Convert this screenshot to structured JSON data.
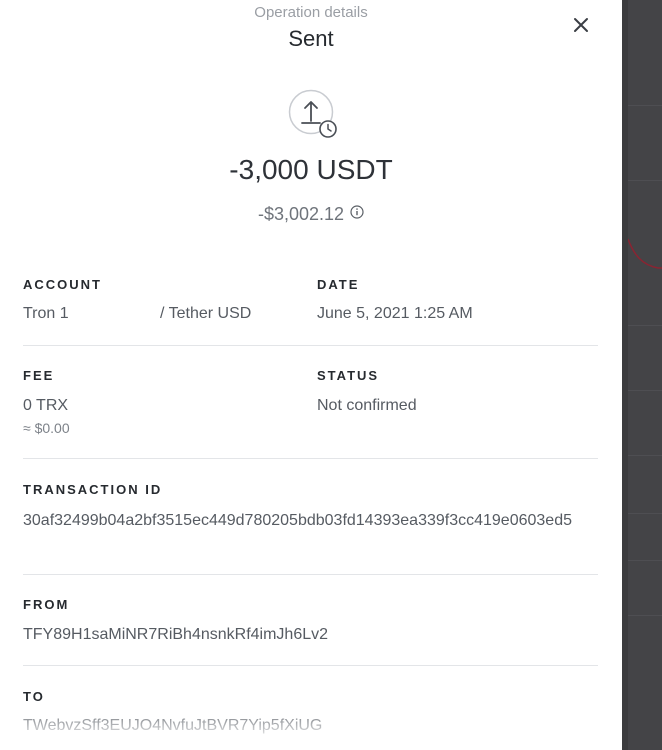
{
  "modal": {
    "subtitle": "Operation details",
    "title": "Sent",
    "amount": "-3,000 USDT",
    "fiat_amount": "-$3,002.12"
  },
  "account": {
    "label": "ACCOUNT",
    "name": "Tron 1",
    "token": "/ Tether USD"
  },
  "date": {
    "label": "DATE",
    "value": "June 5, 2021 1:25 AM"
  },
  "fee": {
    "label": "FEE",
    "value": "0 TRX",
    "fiat": "≈ $0.00"
  },
  "status": {
    "label": "STATUS",
    "value": "Not confirmed"
  },
  "transaction": {
    "label": "TRANSACTION ID",
    "value": "30af32499b04a2bf3515ec449d780205bdb03fd14393ea339f3cc419e0603ed5"
  },
  "from": {
    "label": "FROM",
    "value": "TFY89H1saMiNR7RiBh4nsnkRf4imJh6Lv2"
  },
  "to": {
    "label": "TO",
    "value": "TWebvzSff3EUJO4NvfuJtBVR7Yip5fXiUG"
  },
  "icons": {
    "close": "close-icon",
    "operation": "upload-pending-icon",
    "info": "info-icon"
  },
  "colors": {
    "text_primary": "#262a2f",
    "text_secondary": "#565b62",
    "divider": "#e3e5e8",
    "backdrop": "#3c3c3e"
  }
}
